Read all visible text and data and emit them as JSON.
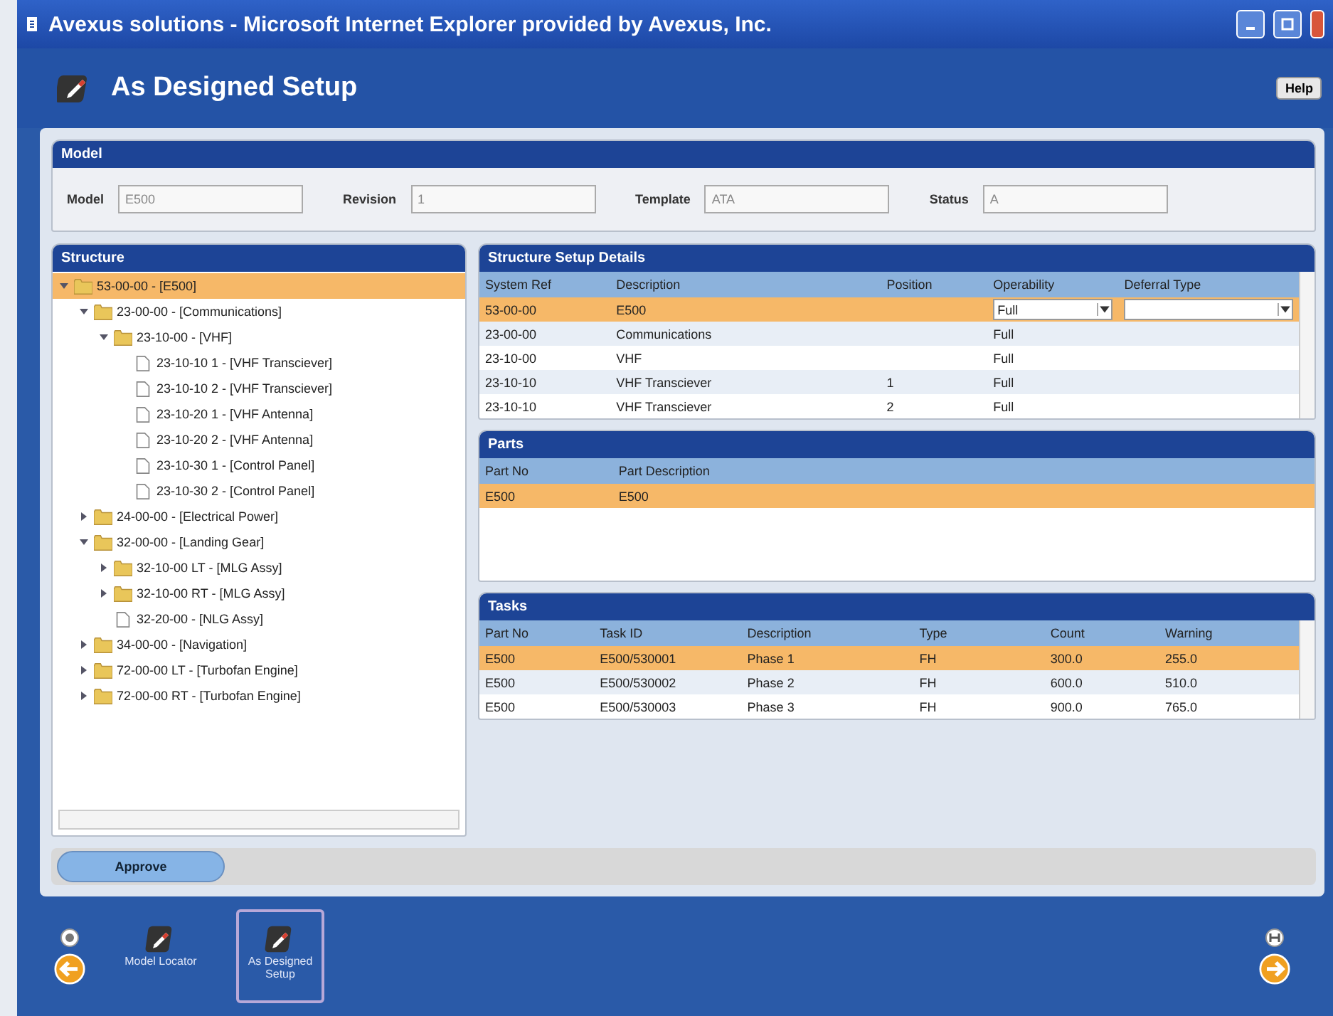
{
  "window": {
    "title": "Avexus solutions - Microsoft Internet Explorer provided by Avexus, Inc."
  },
  "header": {
    "title": "As Designed Setup",
    "help": "Help"
  },
  "model": {
    "title": "Model",
    "fields": [
      {
        "label": "Model",
        "value": "E500"
      },
      {
        "label": "Revision",
        "value": "1"
      },
      {
        "label": "Template",
        "value": "ATA"
      },
      {
        "label": "Status",
        "value": "A"
      }
    ]
  },
  "structure": {
    "title": "Structure",
    "tree": [
      {
        "kind": "folder",
        "label": "53-00-00 - [E500]",
        "selected": true,
        "expanded": true,
        "children": [
          {
            "kind": "folder",
            "label": "23-00-00 - [Communications]",
            "selected": false,
            "expanded": true,
            "children": [
              {
                "kind": "folder",
                "label": "23-10-00 - [VHF]",
                "selected": false,
                "expanded": true,
                "children": [
                  {
                    "kind": "leaf",
                    "label": "23-10-10 1 - [VHF Transciever]",
                    "selected": false
                  },
                  {
                    "kind": "leaf",
                    "label": "23-10-10 2 - [VHF Transciever]",
                    "selected": false
                  },
                  {
                    "kind": "leaf",
                    "label": "23-10-20 1 - [VHF Antenna]",
                    "selected": false
                  },
                  {
                    "kind": "leaf",
                    "label": "23-10-20 2 - [VHF Antenna]",
                    "selected": false
                  },
                  {
                    "kind": "leaf",
                    "label": "23-10-30 1 - [Control Panel]",
                    "selected": false
                  },
                  {
                    "kind": "leaf",
                    "label": "23-10-30 2 - [Control Panel]",
                    "selected": false
                  }
                ]
              }
            ]
          },
          {
            "kind": "folder",
            "label": "24-00-00 - [Electrical Power]",
            "selected": false,
            "expanded": false
          },
          {
            "kind": "folder",
            "label": "32-00-00 - [Landing Gear]",
            "selected": false,
            "expanded": true,
            "children": [
              {
                "kind": "folder",
                "label": "32-10-00 LT - [MLG Assy]",
                "selected": false,
                "expanded": false
              },
              {
                "kind": "folder",
                "label": "32-10-00 RT - [MLG Assy]",
                "selected": false,
                "expanded": false
              },
              {
                "kind": "leaf",
                "label": "32-20-00 - [NLG Assy]",
                "selected": false
              }
            ]
          },
          {
            "kind": "folder",
            "label": "34-00-00 - [Navigation]",
            "selected": false,
            "expanded": false
          },
          {
            "kind": "folder",
            "label": "72-00-00 LT - [Turbofan Engine]",
            "selected": false,
            "expanded": false
          },
          {
            "kind": "folder",
            "label": "72-00-00 RT - [Turbofan Engine]",
            "selected": false,
            "expanded": false
          }
        ]
      }
    ]
  },
  "details": {
    "title": "Structure Setup Details",
    "columns": [
      "System Ref",
      "Description",
      "Position",
      "Operability",
      "Deferral Type"
    ],
    "rows": [
      {
        "cells": [
          "53-00-00",
          "E500",
          "",
          "Full",
          ""
        ],
        "selected": true
      },
      {
        "cells": [
          "23-00-00",
          "Communications",
          "",
          "Full",
          ""
        ],
        "selected": false
      },
      {
        "cells": [
          "23-10-00",
          "VHF",
          "",
          "Full",
          ""
        ],
        "selected": false
      },
      {
        "cells": [
          "23-10-10",
          "VHF Transciever",
          "1",
          "Full",
          ""
        ],
        "selected": false
      },
      {
        "cells": [
          "23-10-10",
          "VHF Transciever",
          "2",
          "Full",
          ""
        ],
        "selected": false
      }
    ]
  },
  "parts": {
    "title": "Parts",
    "columns": [
      "Part No",
      "Part Description"
    ],
    "rows": [
      {
        "cells": [
          "E500",
          "E500"
        ],
        "selected": true
      }
    ]
  },
  "tasks": {
    "title": "Tasks",
    "columns": [
      "Part No",
      "Task ID",
      "Description",
      "Type",
      "Count",
      "Warning"
    ],
    "rows": [
      {
        "cells": [
          "E500",
          "E500/530001",
          "Phase 1",
          "FH",
          "300.0",
          "255.0"
        ],
        "selected": true
      },
      {
        "cells": [
          "E500",
          "E500/530002",
          "Phase 2",
          "FH",
          "600.0",
          "510.0"
        ],
        "selected": false
      },
      {
        "cells": [
          "E500",
          "E500/530003",
          "Phase 3",
          "FH",
          "900.0",
          "765.0"
        ],
        "selected": false
      }
    ]
  },
  "approve": "Approve",
  "nav": [
    {
      "label": "Model Locator",
      "selected": false
    },
    {
      "label": "As Designed Setup",
      "selected": true
    }
  ]
}
